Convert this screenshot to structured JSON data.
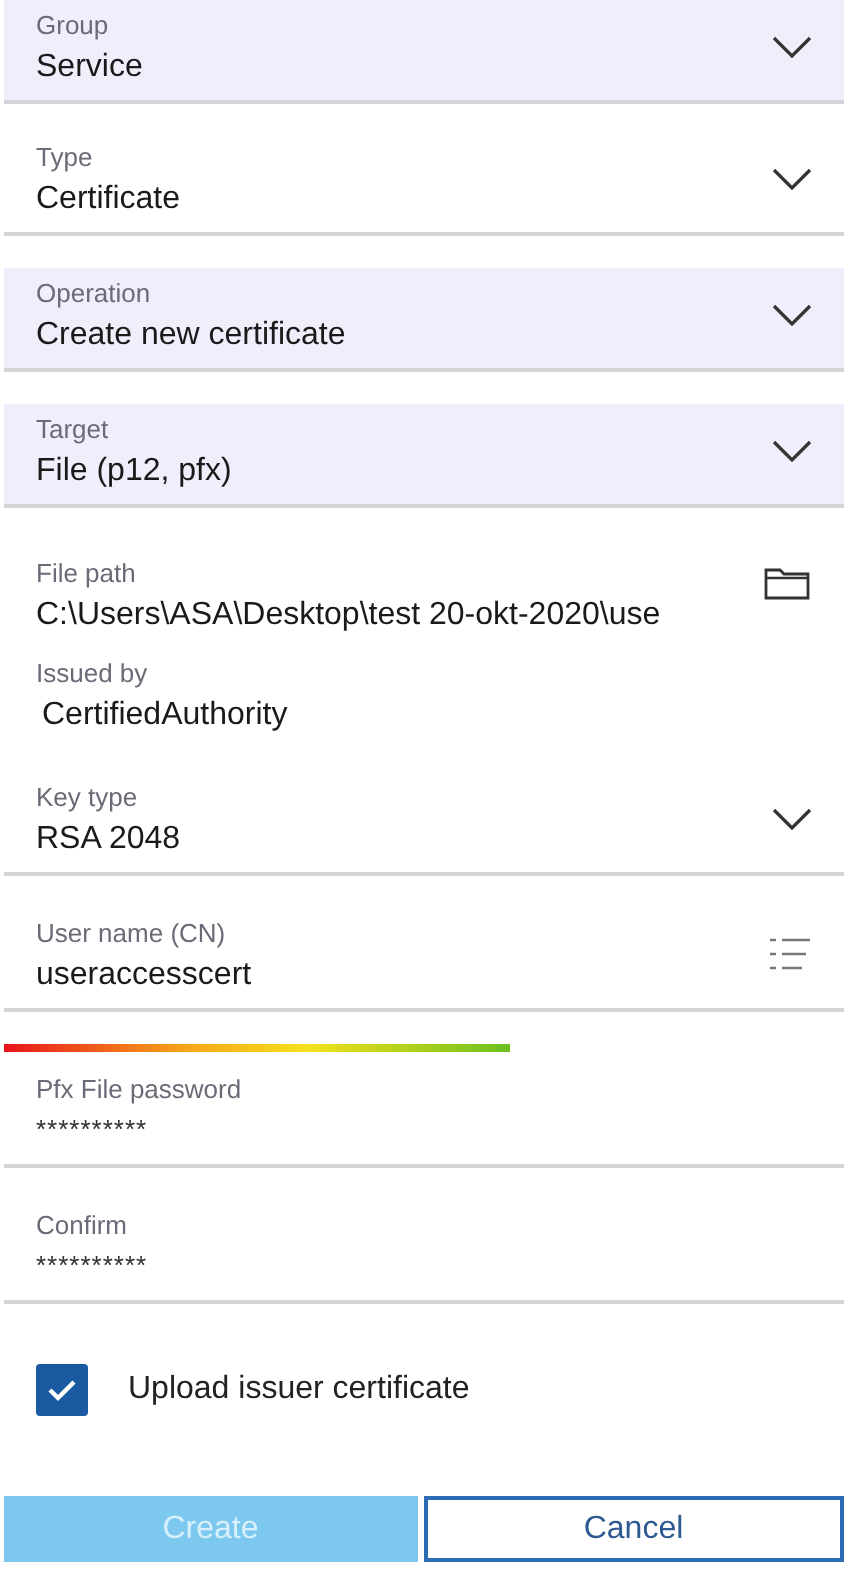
{
  "fields": [
    {
      "kind": "dropdown",
      "label": "Group",
      "value": "Service",
      "highlighted": true
    },
    {
      "kind": "dropdown",
      "label": "Type",
      "value": "Certificate",
      "highlighted": false
    },
    {
      "kind": "dropdown",
      "label": "Operation",
      "value": "Create new certificate",
      "highlighted": true
    },
    {
      "kind": "dropdown",
      "label": "Target",
      "value": "File (p12, pfx)",
      "highlighted": true
    },
    {
      "kind": "browse",
      "label": "File path",
      "value": "C:\\Users\\ASA\\Desktop\\test 20-okt-2020\\use"
    },
    {
      "kind": "readonly",
      "label": "Issued by",
      "value": "CertifiedAuthority"
    },
    {
      "kind": "dropdown",
      "label": "Key type",
      "value": "RSA 2048",
      "highlighted": false
    },
    {
      "kind": "list",
      "label": "User name (CN)",
      "value": "useraccesscert"
    },
    {
      "kind": "strength"
    },
    {
      "kind": "password",
      "label": "Pfx File password",
      "value": "**********"
    },
    {
      "kind": "password",
      "label": "Confirm",
      "value": "**********"
    }
  ],
  "checkbox": {
    "label": "Upload issuer certificate",
    "checked": true
  },
  "buttons": [
    {
      "label": "Create",
      "kind": "primary",
      "disabled": true
    },
    {
      "label": "Cancel",
      "kind": "secondary",
      "disabled": false
    }
  ]
}
